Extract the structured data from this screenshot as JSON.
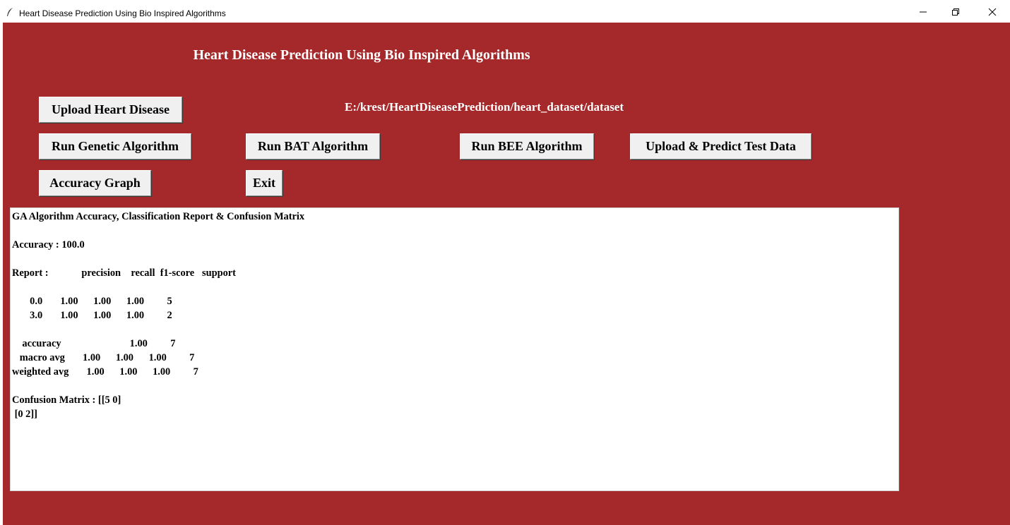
{
  "window": {
    "title": "Heart Disease Prediction Using Bio Inspired Algorithms",
    "icon": "feather-icon",
    "controls": [
      "minimize-icon",
      "restore-icon",
      "close-icon"
    ]
  },
  "heading": "Heart Disease Prediction Using Bio Inspired Algorithms",
  "dataset_path": "E:/krest/HeartDiseasePrediction/heart_dataset/dataset",
  "buttons": {
    "upload": "Upload Heart Disease",
    "genetic": "Run Genetic Algorithm",
    "bat": "Run BAT Algorithm",
    "bee": "Run BEE Algorithm",
    "predict": "Upload & Predict Test Data",
    "graph": "Accuracy Graph",
    "exit": "Exit"
  },
  "output_text": "GA Algorithm Accuracy, Classification Report & Confusion Matrix\n\nAccuracy : 100.0\n\nReport :             precision    recall  f1-score   support\n\n       0.0       1.00      1.00      1.00         5\n       3.0       1.00      1.00      1.00         2\n\n    accuracy                           1.00         7\n   macro avg       1.00      1.00      1.00         7\nweighted avg       1.00      1.00      1.00         7\n\nConfusion Matrix : [[5 0]\n [0 2]]",
  "colors": {
    "background": "#a5292a",
    "button_face": "#f0f0f0",
    "text_area": "#ffffff",
    "heading_text": "#ffffff"
  }
}
